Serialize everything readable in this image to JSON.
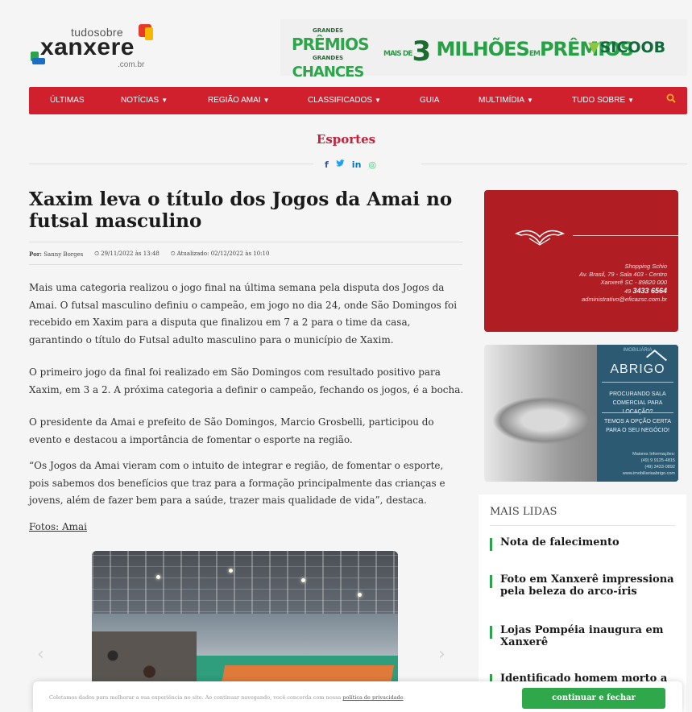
{
  "logo": {
    "top": "tudosobre",
    "main": "xanxere",
    "sub": ".com.br"
  },
  "banner": {
    "chances_l1": "GRANDES",
    "chances_l2": "PRÊMIOS",
    "chances_l3": "CHANCES",
    "chances_l4": "GRANDES",
    "milhoes_pre": "MAIS DE",
    "milhoes_num": "3",
    "milhoes_text": "MILHÕES",
    "milhoes_em": "EM",
    "milhoes_premios": "PRÊMIOS",
    "sponsor": "SICOOB"
  },
  "nav": {
    "items": [
      {
        "label": "ÚLTIMAS",
        "dropdown": false
      },
      {
        "label": "NOTÍCIAS",
        "dropdown": true
      },
      {
        "label": "REGIÃO AMAI",
        "dropdown": true
      },
      {
        "label": "CLASSIFICADOS",
        "dropdown": true
      },
      {
        "label": "GUIA",
        "dropdown": false
      },
      {
        "label": "MULTIMÍDIA",
        "dropdown": true
      },
      {
        "label": "TUDO SOBRE",
        "dropdown": true
      }
    ],
    "search_icon": "search-icon"
  },
  "section": "Esportes",
  "share": {
    "facebook": "f",
    "twitter": "𝕥",
    "linkedin": "in",
    "whatsapp": "◎"
  },
  "colors": {
    "brand_red": "#d0202e",
    "section_red": "#c4213a",
    "accent_green": "#2aa34a",
    "search_orange": "#f5a623",
    "facebook": "#3b5998",
    "twitter": "#1da1f2",
    "linkedin": "#0077b5",
    "whatsapp": "#25d366"
  },
  "article": {
    "title": "Xaxim leva o título dos Jogos da Amai no futsal masculino",
    "author_label": "Por:",
    "author": "Sanny Borges",
    "published": "29/11/2022 às 13:48",
    "updated": "Atualizado: 02/12/2022 às 10:10",
    "paragraphs": [
      "Mais uma categoria realizou o jogo final na última semana pela disputa dos Jogos da Amai. O futsal masculino definiu o campeão, em jogo no dia 24, onde São Domingos foi recebido em Xaxim para a disputa que finalizou em 7 a 2 para o time da casa, garantindo o título do Futsal adulto masculino para o município de Xaxim.",
      "O primeiro jogo da final foi realizado em São Domingos com resultado positivo para Xaxim, em 3 a 2. A próxima categoria a definir o campeão, fechando os jogos, é a bocha.",
      "O presidente da Amai e prefeito de São Domingos, Marcio Grosbelli, participou do evento e destacou a importância de fomentar o esporte na região.",
      "“Os Jogos da Amai vieram com o intuito de integrar e região, de fomentar o esporte, pois sabemos dos benefícios que traz para a formação principalmente das crianças e jovens, além de fazer bem para a saúde, trazer mais qualidade de vida”, destaca."
    ],
    "photo_credit": "Fotos: Amai"
  },
  "ad1": {
    "line1": "Shopping Schio",
    "line2": "Av. Brasil, 79 - Sala 403 - Centro",
    "line3": "Xanxerê SC - 89820 000",
    "phone_prefix": "49",
    "phone": "3433 6564",
    "email": "administrativo@eficazsc.com.br"
  },
  "ad2": {
    "brand_top": "IMOBILIÁRIA",
    "brand": "ABRIGO",
    "text1": "PROCURANDO SALA COMERCIAL PARA LOCAÇÃO?",
    "text2": "TEMOS A OPÇÃO CERTA PARA O SEU NEGÓCIO!",
    "info_label": "Maiores Informações:",
    "phone1": "(49) 9 9125-4815",
    "phone2": "(49) 3433-0892",
    "site": "www.imobiliariaabrigo.com"
  },
  "mais_lidas": {
    "title": "MAIS LIDAS",
    "items": [
      "Nota de falecimento",
      "Foto em Xanxerê impressiona pela beleza do arco-íris",
      "Lojas Pompéia inaugura em Xanxerê",
      "Identificado homem morto a"
    ]
  },
  "cookie": {
    "text": "Coletamos dados para melhorar a sua experiência no site. Ao continuar navegando, você concorda com nossa",
    "link": "política de privacidade",
    "period": ".",
    "button": "continuar e fechar"
  }
}
